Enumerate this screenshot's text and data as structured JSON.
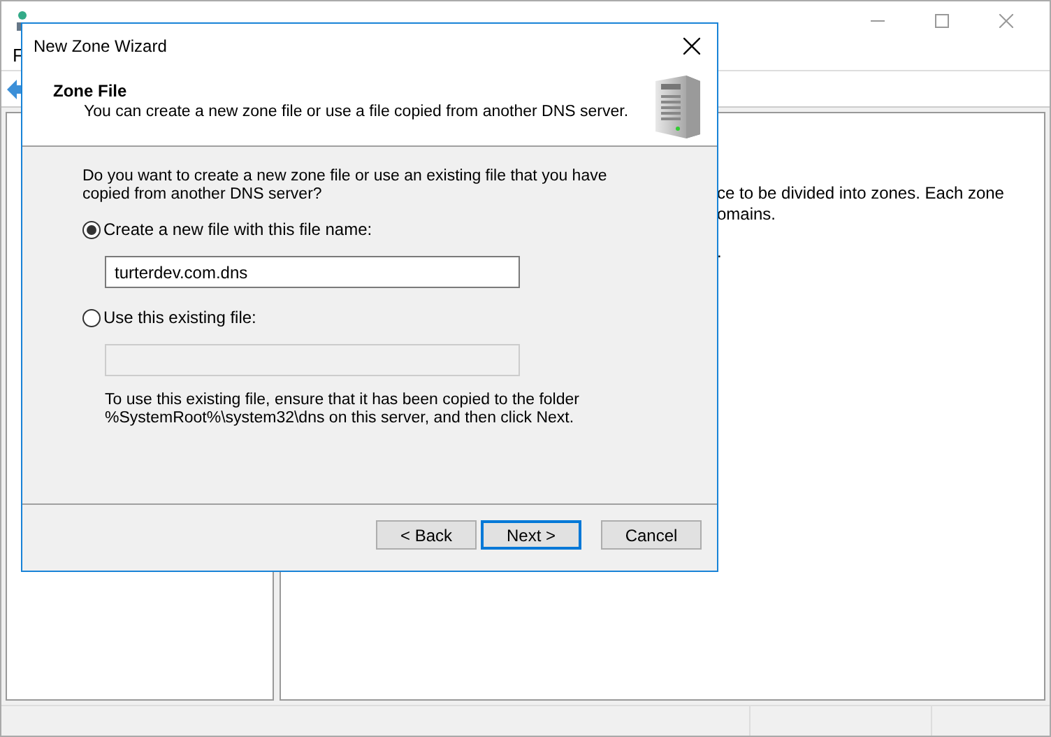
{
  "main_window": {
    "menu": [
      "F"
    ],
    "content_lines": [
      "ce to be divided into zones. Each zone",
      "omains.",
      "."
    ]
  },
  "dialog": {
    "title": "New Zone Wizard",
    "header": {
      "title": "Zone File",
      "subtitle": "You can create a new zone file or use a file copied from another DNS server."
    },
    "question": "Do you want to create a new zone file or use an existing file that you have copied from another DNS server?",
    "options": [
      {
        "label": "Create a new file with this file name:",
        "selected": true,
        "value": "turterdev.com.dns"
      },
      {
        "label": "Use this existing file:",
        "selected": false
      }
    ],
    "note": "To use this existing file, ensure that it has been copied to the folder %SystemRoot%\\system32\\dns on this server, and then click Next.",
    "buttons": [
      {
        "label": "< Back",
        "focused": false
      },
      {
        "label": "Next >",
        "focused": true
      },
      {
        "label": "Cancel",
        "focused": false
      }
    ]
  }
}
